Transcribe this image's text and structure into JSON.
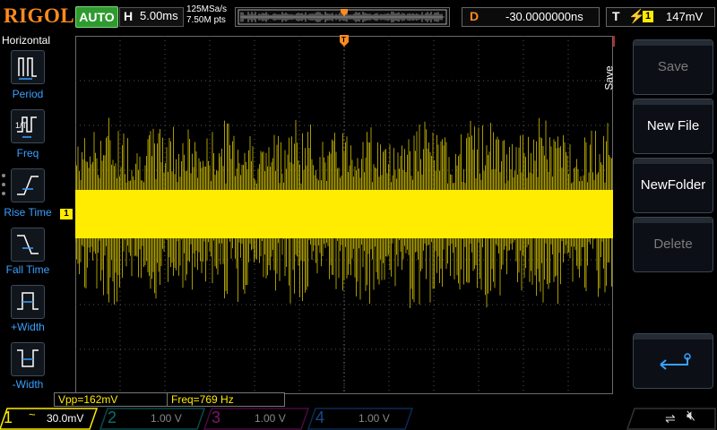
{
  "top": {
    "logo": "RIGOL",
    "run_mode": "AUTO",
    "horizontal_key": "H",
    "timebase": "5.00ms",
    "sample_rate": "125MSa/s",
    "memory_depth": "7.50M pts",
    "delay_key": "D",
    "delay": "-30.0000000ns",
    "trigger_key": "T",
    "trigger_source": "1",
    "trigger_level": "147mV"
  },
  "left_menu": {
    "title": "Horizontal",
    "items": [
      {
        "label": "Period"
      },
      {
        "label": "Freq"
      },
      {
        "label": "Rise Time"
      },
      {
        "label": "Fall Time"
      },
      {
        "label": "+Width"
      },
      {
        "label": "-Width"
      }
    ]
  },
  "right_menu": {
    "title": "Save",
    "buttons": [
      {
        "label": "Save",
        "enabled": false
      },
      {
        "label": "New File",
        "enabled": true
      },
      {
        "label": "NewFolder",
        "enabled": true
      },
      {
        "label": "Delete",
        "enabled": false
      },
      {
        "label": "",
        "icon": "enter-return-icon",
        "enabled": true
      }
    ]
  },
  "channel1_marker": "1",
  "measurements": {
    "vpp": "Vpp=162mV",
    "freq": "Freq=769 Hz"
  },
  "channels": [
    {
      "num": "1",
      "coupling": "~",
      "scale": "30.0mV",
      "color": "#ffec00",
      "active": true
    },
    {
      "num": "2",
      "coupling": "",
      "scale": "1.00 V",
      "color": "#0fd3d6",
      "active": false
    },
    {
      "num": "3",
      "coupling": "",
      "scale": "1.00 V",
      "color": "#ff2fd0",
      "active": false
    },
    {
      "num": "4",
      "coupling": "",
      "scale": "1.00 V",
      "color": "#1ea0ff",
      "active": false
    }
  ],
  "colors": {
    "ch1": "#ffec00",
    "brand": "#ff8a1e",
    "menu_accent": "#3aa0ff",
    "auto": "#2f9a2f"
  }
}
